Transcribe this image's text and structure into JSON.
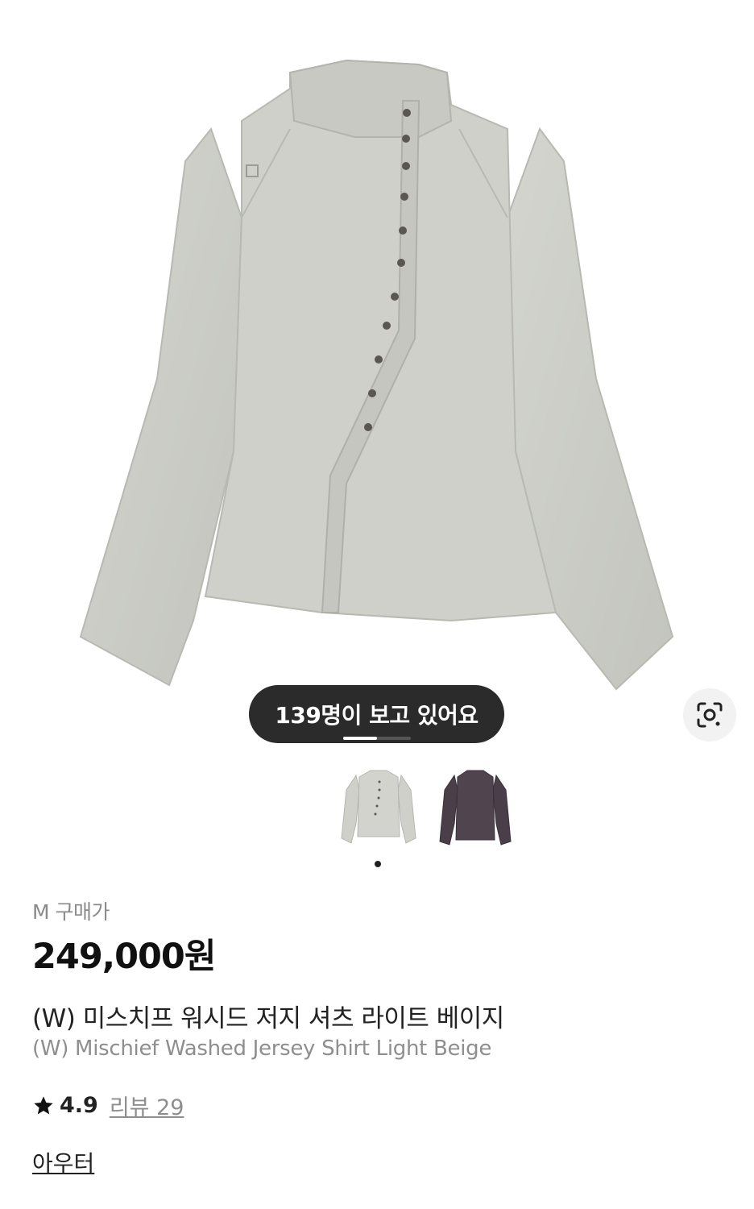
{
  "viewer_badge": {
    "text": "139명이 보고 있어요",
    "progress": 0.5
  },
  "thumbnails": [
    {
      "color_name": "light-beige",
      "color": "#cfd0ca",
      "selected": true
    },
    {
      "color_name": "dark-purple",
      "color": "#4a3f48",
      "selected": false
    }
  ],
  "product": {
    "size_label": "M 구매가",
    "price": "249,000원",
    "name_ko": "(W) 미스치프 워시드 저지 셔츠 라이트 베이지",
    "name_en": "(W) Mischief Washed Jersey Shirt Light Beige",
    "rating": "4.9",
    "review_label": "리뷰 29",
    "category": "아우터"
  },
  "icons": {
    "lens": "image-search-icon",
    "star": "star-icon"
  }
}
